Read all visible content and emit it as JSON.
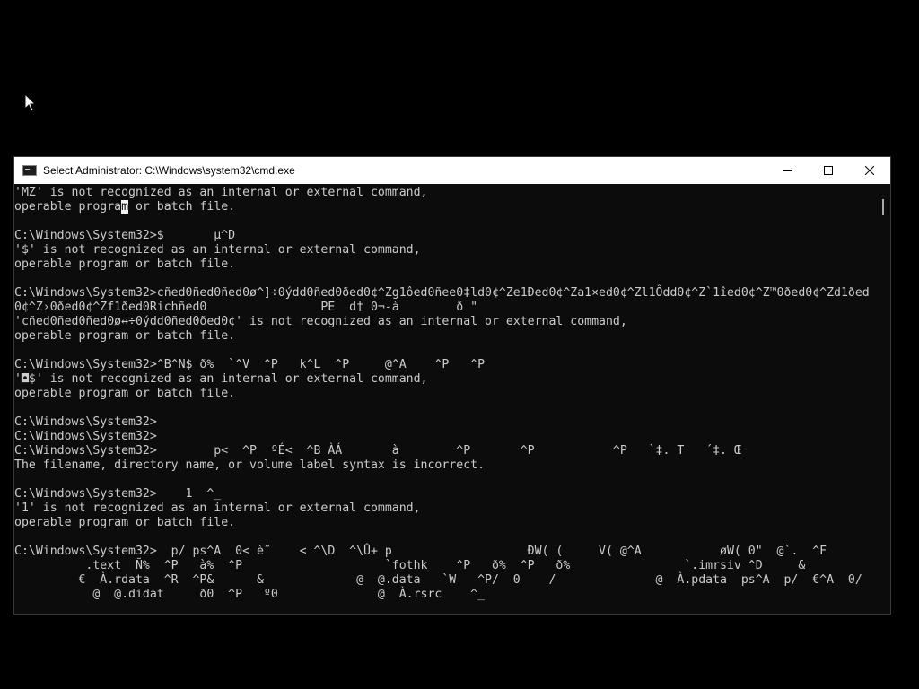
{
  "window": {
    "title": "Select Administrator: C:\\Windows\\system32\\cmd.exe"
  },
  "icons": {
    "app": "cmd-icon",
    "minimize": "minimize-icon",
    "maximize": "maximize-icon",
    "close": "close-icon",
    "pointer": "mouse-pointer-icon"
  },
  "colors": {
    "console_background": "#0c0c0c",
    "console_text": "#cccccc",
    "titlebar": "#ffffff"
  },
  "console": {
    "lines": [
      "'MZ' is not recognized as an internal or external command,",
      "operable program or batch file.",
      "",
      "C:\\Windows\\System32>$       µ^D",
      "'$' is not recognized as an internal or external command,",
      "operable program or batch file.",
      "",
      "C:\\Windows\\System32>cñed0ñed0ñed0ø^]÷0ýdd0ñed0ðed0¢^Zg1ôed0ñee0‡ld0¢^Ze1Ðed0¢^Za1×ed0¢^Zl1Ôdd0¢^Z`1îed0¢^Z™0ðed0¢^Zd1ðed",
      "0¢^Z›0ðed0¢^Zf1ðed0Richñed0                PE  d† 0¬-à        ð \"",
      "'cñed0ñed0ñed0ø↔÷0ýdd0ñed0ðed0¢' is not recognized as an internal or external command,",
      "operable program or batch file.",
      "",
      "C:\\Windows\\System32>^B^N$ ð%  `^V  ^P   k^L  ^P     @^A    ^P   ^P",
      "'◘$' is not recognized as an internal or external command,",
      "operable program or batch file.",
      "",
      "C:\\Windows\\System32>",
      "C:\\Windows\\System32>",
      "C:\\Windows\\System32>        p<  ^P  ºÉ<  ^B ÀÁ       à        ^P       ^P           ^P   `‡. T   ´‡. Œ",
      "The filename, directory name, or volume label syntax is incorrect.",
      "",
      "C:\\Windows\\System32>    1  ^_",
      "'1' is not recognized as an internal or external command,",
      "operable program or batch file.",
      "",
      "C:\\Windows\\System32>  p/ ps^A  0< è˜    < ^\\D  ^\\Û+ p                   ÐW( (     V( @^A           øW( 0\"  @`.  ^F",
      "          .text  Ñ%  ^P   à%  ^P                    `fothk    ^P   ð%  ^P   ð%                `.imrsiv ^D     &",
      "         €  À.rdata  ^R  ^P&      &             @  @.data   `W   ^P/  0    /              @  À.pdata  ps^A  p/  €^A  0/",
      "           @  @.didat     ð0  ^P   º0              @  À.rsrc    ^_"
    ],
    "selection": {
      "line_before": "operable progra",
      "char": "m",
      "line_after": " or batch file."
    }
  }
}
